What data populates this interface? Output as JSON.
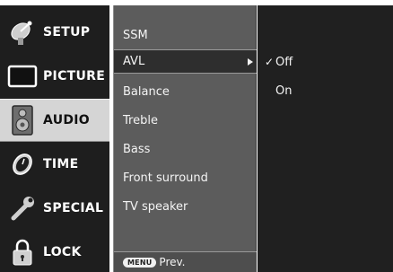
{
  "sidebar": {
    "items": [
      {
        "label": "SETUP",
        "icon": "satellite-dish-icon",
        "active": false
      },
      {
        "label": "PICTURE",
        "icon": "tv-screen-icon",
        "active": false
      },
      {
        "label": "AUDIO",
        "icon": "speaker-icon",
        "active": true
      },
      {
        "label": "TIME",
        "icon": "clock-icon",
        "active": false
      },
      {
        "label": "SPECIAL",
        "icon": "wrench-icon",
        "active": false
      },
      {
        "label": "LOCK",
        "icon": "padlock-icon",
        "active": false
      }
    ]
  },
  "menu": {
    "items": [
      {
        "label": "SSM"
      },
      {
        "label": "AVL",
        "selected": true
      },
      {
        "label": "Balance"
      },
      {
        "label": "Treble"
      },
      {
        "label": "Bass"
      },
      {
        "label": "Front surround"
      },
      {
        "label": "TV speaker"
      }
    ],
    "footer": {
      "key_label": "MENU",
      "label": "Prev."
    }
  },
  "submenu": {
    "options": [
      {
        "label": "Off",
        "checked": true,
        "check_mark": "✓"
      },
      {
        "label": "On",
        "checked": false
      }
    ]
  },
  "colors": {
    "sidebar_bg": "#1e1e1e",
    "active_category_bg": "#d5d5d5",
    "menu_bg": "#5c5c5c",
    "selected_row_bg": "#2e2e2e",
    "submenu_bg": "#202020"
  }
}
